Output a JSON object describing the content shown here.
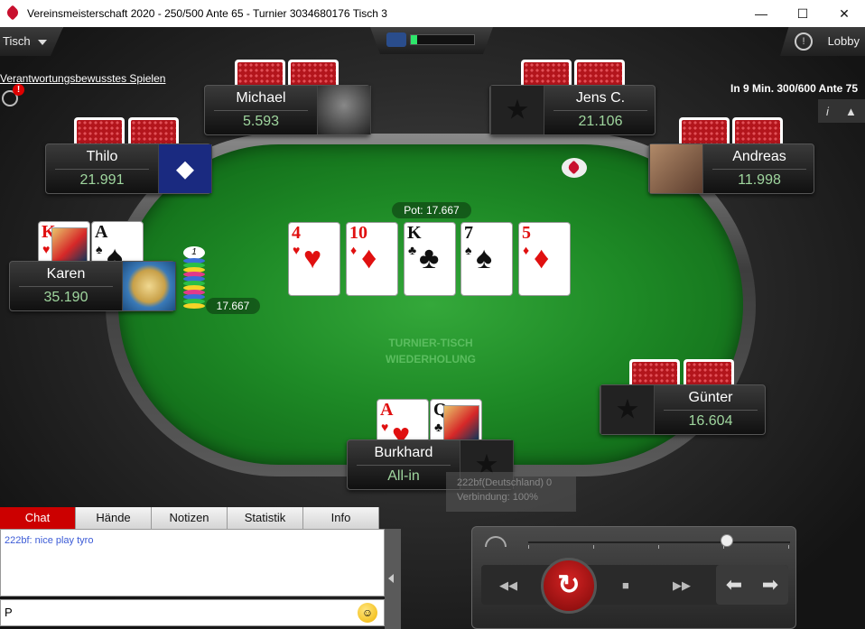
{
  "window": {
    "title": "Vereinsmeisterschaft 2020 - 250/500 Ante 65 - Turnier 3034680176 Tisch 3",
    "minimize": "—",
    "maximize": "☐",
    "close": "✕"
  },
  "toolbar": {
    "tisch_menu": "Tisch",
    "lobby_button": "Lobby",
    "clock_icon": "clock-icon",
    "responsible_link": "Verantwortungsbewusstes Spielen",
    "blind_info": "In 9 Min. 300/600 Ante 75",
    "info_button": "i"
  },
  "table": {
    "felt_text_line1": "TURNIER-TISCH",
    "felt_text_line2": "WIEDERHOLUNG",
    "pot_label": "Pot: 17.667",
    "board": [
      {
        "rank": "4",
        "suit": "♥",
        "color": "red"
      },
      {
        "rank": "10",
        "suit": "♦",
        "color": "red"
      },
      {
        "rank": "K",
        "suit": "♣",
        "color": "blk"
      },
      {
        "rank": "7",
        "suit": "♠",
        "color": "blk"
      },
      {
        "rank": "5",
        "suit": "♦",
        "color": "red"
      }
    ],
    "bet_amount": "17.667"
  },
  "players": {
    "michael": {
      "name": "Michael",
      "stack": "5.593"
    },
    "jens": {
      "name": "Jens C.",
      "stack": "21.106"
    },
    "thilo": {
      "name": "Thilo",
      "stack": "21.991"
    },
    "andreas": {
      "name": "Andreas",
      "stack": "11.998"
    },
    "karen": {
      "name": "Karen",
      "stack": "35.190",
      "cards": [
        {
          "rank": "K",
          "suit": "♥",
          "color": "red"
        },
        {
          "rank": "A",
          "suit": "♠",
          "color": "blk"
        }
      ]
    },
    "guenter": {
      "name": "Günter",
      "stack": "16.604"
    },
    "burkhard": {
      "name": "Burkhard",
      "stack": "All-in",
      "cards": [
        {
          "rank": "A",
          "suit": "♥",
          "color": "red"
        },
        {
          "rank": "Q",
          "suit": "♣",
          "color": "blk"
        }
      ]
    }
  },
  "tooltip": {
    "line1": "222bf(Deutschland) 0",
    "line2": "Verbindung: 100%"
  },
  "chat": {
    "tabs": [
      "Chat",
      "Hände",
      "Notizen",
      "Statistik",
      "Info"
    ],
    "active_tab": "Chat",
    "messages": [
      {
        "text": "222bf: nice play tyro"
      }
    ],
    "input_value": "P",
    "smiley": "☺"
  },
  "replay": {
    "speed_fraction": 0.76,
    "rewind_label": "◀◀",
    "restart_label": "↻",
    "stop_label": "■",
    "forward_label": "▶▶",
    "prev_label": "⬅",
    "next_label": "➡"
  }
}
